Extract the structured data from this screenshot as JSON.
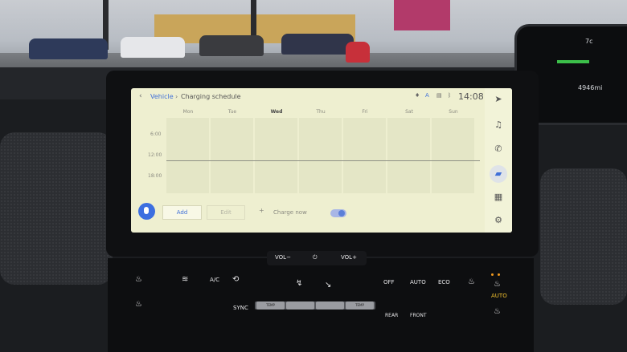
{
  "screen": {
    "breadcrumb": {
      "parent": "Vehicle",
      "title": "Charging schedule"
    },
    "clock": "14:08",
    "days": [
      "Mon",
      "Tue",
      "Wed",
      "Thu",
      "Fri",
      "Sat",
      "Sun"
    ],
    "active_day": "Wed",
    "time_labels": [
      "6:00",
      "12:00",
      "18:00"
    ],
    "actions": {
      "add": "Add",
      "edit": "Edit",
      "charge_now": "Charge now",
      "charge_now_toggle": true
    },
    "accent_color": "#3f6fd8"
  },
  "cluster": {
    "temperature": "7c",
    "odometer": "4946mi"
  },
  "controls": {
    "vol_down": "VOL−",
    "vol_up": "VOL+",
    "ac": "A/C",
    "sync": "SYNC",
    "off": "OFF",
    "auto": "AUTO",
    "eco": "ECO",
    "auto_right": "AUTO",
    "rear": "REAR",
    "front": "FRONT",
    "temp_left": "TEMP",
    "temp_right": "TEMP"
  }
}
